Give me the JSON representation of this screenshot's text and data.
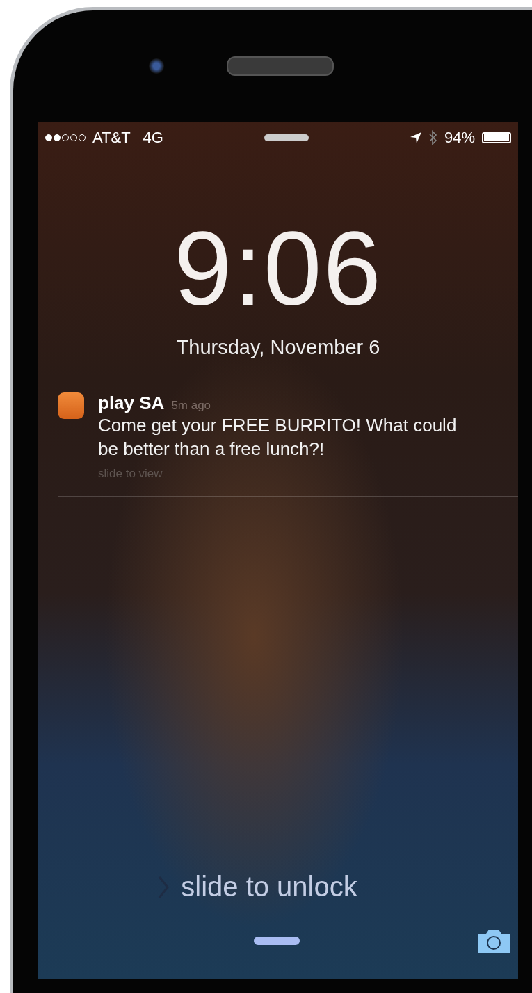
{
  "status_bar": {
    "carrier": "AT&T",
    "network": "4G",
    "battery": "94%"
  },
  "lock_screen": {
    "time": "9:06",
    "date": "Thursday, November 6"
  },
  "notifications": [
    {
      "app": "play SA",
      "age": "5m ago",
      "message": "Come get your FREE BURRITO! What could be better than a free lunch?!",
      "action": "slide to view"
    }
  ],
  "unlock": {
    "label": "slide to unlock"
  }
}
